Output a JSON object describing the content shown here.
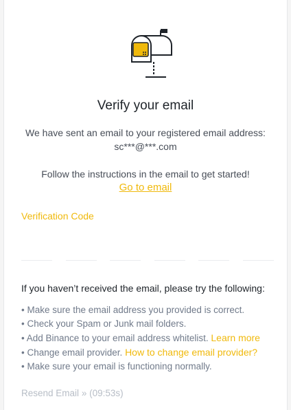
{
  "title": "Verify your email",
  "description": {
    "line1": "We have sent an email to your registered email address:",
    "email": "sc***@***.com",
    "instructions": "Follow the instructions in the email to get started!",
    "go_to_email": "Go to email"
  },
  "verification": {
    "label": "Verification Code",
    "digits": [
      "",
      "",
      "",
      "",
      "",
      ""
    ]
  },
  "help": {
    "heading": "If you haven’t received the email, please try the following:",
    "tips": [
      {
        "text": "• Make sure the email address you provided is correct.",
        "link": ""
      },
      {
        "text": "• Check your Spam or Junk mail folders.",
        "link": ""
      },
      {
        "text": "• Add Binance to your email address whitelist. ",
        "link": "Learn more"
      },
      {
        "text": "• Change email provider. ",
        "link": "How to change email provider?"
      },
      {
        "text": "• Make sure your email is functioning normally.",
        "link": ""
      }
    ]
  },
  "resend": {
    "label": "Resend Email",
    "chevron": "»",
    "timer": "(09:53s)"
  },
  "colors": {
    "accent": "#f0b90b",
    "text_primary": "#1e2329",
    "text_secondary": "#707a8a",
    "disabled": "#b7bdc6"
  },
  "icons": {
    "illustration": "mailbox-illustration"
  }
}
